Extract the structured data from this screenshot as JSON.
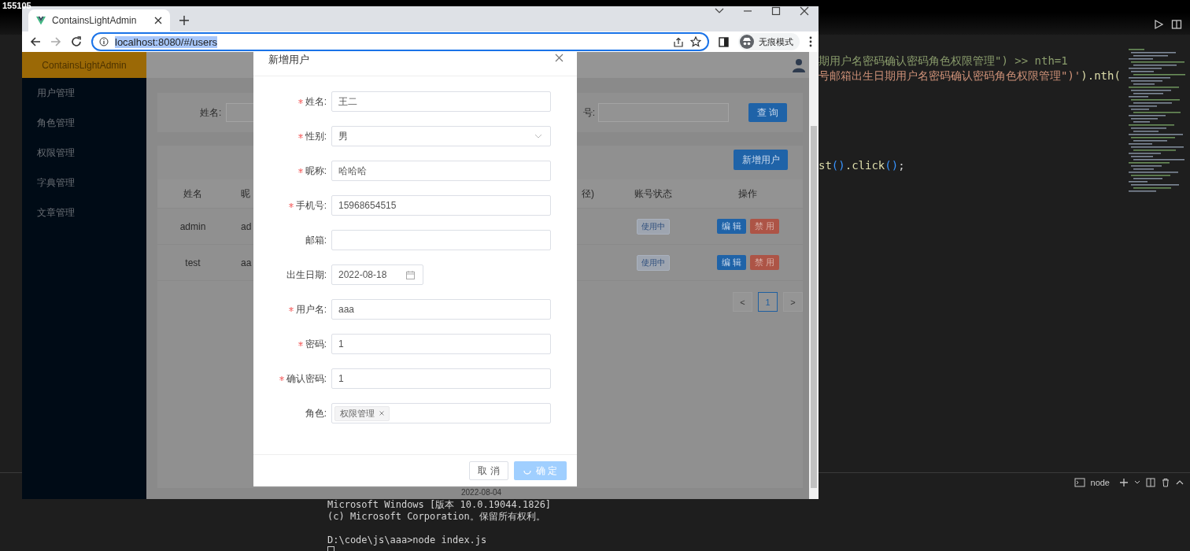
{
  "recording_label": "155105",
  "browser": {
    "tab_title": "ContainsLightAdmin",
    "url": "localhost:8080/#/users",
    "url_selected": true,
    "profile": "无痕模式"
  },
  "app": {
    "logo": "ContainsLightAdmin",
    "menu": [
      {
        "label": "用户管理"
      },
      {
        "label": "角色管理"
      },
      {
        "label": "权限管理"
      },
      {
        "label": "字典管理"
      },
      {
        "label": "文章管理"
      }
    ],
    "search": {
      "fields": [
        {
          "label": "姓名:"
        },
        {
          "label": "号:"
        }
      ],
      "button": "查 询"
    },
    "add_button": "新增用户",
    "table": {
      "columns": [
        "姓名",
        "昵",
        "径)",
        "账号状态",
        "操作"
      ],
      "rows": [
        {
          "cells": [
            "admin",
            "ad"
          ],
          "status": "使用中",
          "actions": [
            {
              "label": "编 辑",
              "kind": "edit"
            },
            {
              "label": "禁 用",
              "kind": "disable"
            }
          ]
        },
        {
          "cells": [
            "test",
            "aa"
          ],
          "status": "使用中",
          "actions": [
            {
              "label": "编 辑",
              "kind": "edit"
            },
            {
              "label": "禁 用",
              "kind": "disable"
            }
          ]
        }
      ]
    },
    "pagination": {
      "prev": "<",
      "next": ">",
      "pages": [
        {
          "label": "1",
          "selected": true
        }
      ]
    }
  },
  "dialog": {
    "title": "新增用户",
    "fields": [
      {
        "label": "姓名:",
        "required": true,
        "kind": "text",
        "value": "王二"
      },
      {
        "label": "性别:",
        "required": true,
        "kind": "select",
        "value": "男"
      },
      {
        "label": "昵称:",
        "required": true,
        "kind": "text",
        "value": "哈哈哈"
      },
      {
        "label": "手机号:",
        "required": true,
        "kind": "text",
        "value": "15968654515"
      },
      {
        "label": "邮箱:",
        "required": false,
        "kind": "text"
      },
      {
        "label": "出生日期:",
        "required": false,
        "kind": "date",
        "value": "2022-08-18"
      },
      {
        "label": "用户名:",
        "required": true,
        "kind": "text",
        "value": "aaa"
      },
      {
        "label": "密码:",
        "required": true,
        "kind": "text",
        "value": "1"
      },
      {
        "label": "确认密码:",
        "required": true,
        "kind": "text",
        "value": "1"
      },
      {
        "label": "角色:",
        "required": false,
        "kind": "tags",
        "tags": [
          "权限管理"
        ]
      }
    ],
    "buttons": [
      {
        "label": "取 消",
        "kind": "default",
        "loading": false
      },
      {
        "label": "确 定",
        "kind": "primary",
        "loading": true
      }
    ]
  },
  "date_cell": "2022-08-04",
  "editor": {
    "lines": [
      {
        "tokens": [
          {
            "text": "期用户名密码确认密码角色权限管理\") >> nth=1",
            "color": "#8a9c6c"
          }
        ]
      },
      {
        "tokens": [
          {
            "text": "号邮箱出生日期用户名密码确认密码角色权限管理\")'",
            "color": "#ce9178"
          },
          {
            "text": ").nth(",
            "color": "#dcdcaa"
          }
        ]
      },
      {
        "tokens": [
          {
            "text": "st",
            "color": "#dcdcaa"
          },
          {
            "text": "()",
            "color": "#3794ff"
          },
          {
            "text": ".click",
            "color": "#dcdcaa"
          },
          {
            "text": "()",
            "color": "#3794ff"
          },
          {
            "text": ";",
            "color": "#d4d4d4"
          }
        ]
      }
    ]
  },
  "terminal": {
    "tab": "node",
    "lines": [
      "Microsoft Windows [版本 10.0.19044.1826]",
      "(c) Microsoft Corporation。保留所有权利。",
      "D:\\code\\js\\aaa>node index.js"
    ]
  }
}
